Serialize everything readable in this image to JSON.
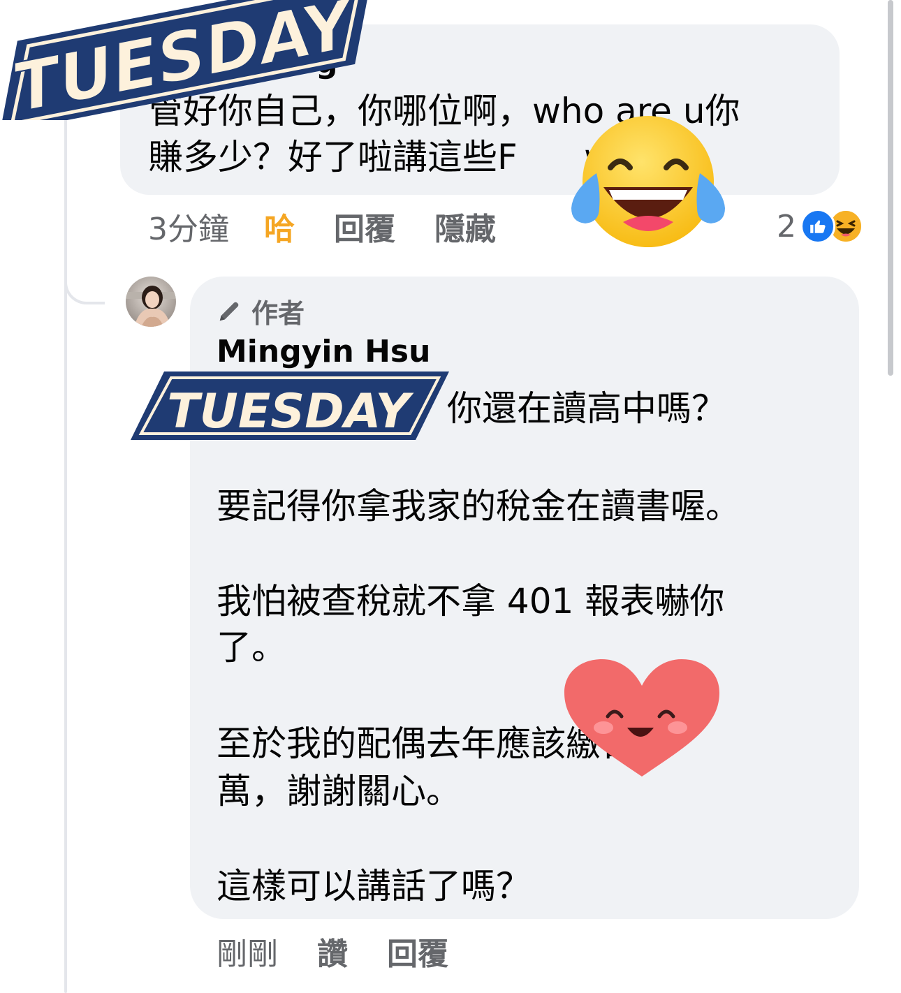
{
  "comment": {
    "author_partial": "g",
    "text": "管好你自己，你哪位啊，who are u你\n賺多少？好了啦講這些F      words",
    "time": "3分鐘",
    "reaction_label": "哈",
    "reply_label": "回覆",
    "hide_label": "隱藏",
    "reaction_count": "2"
  },
  "reply": {
    "badge": "作者",
    "author": "Mingyin Hsu",
    "lines": [
      "你還在讀高中嗎？",
      "要記得你拿我家的稅金在讀書喔。",
      "我怕被查稅就不拿 401 報表嚇你",
      "了。",
      "至於我的配偶去年應該繳百多",
      "萬，謝謝關心。",
      "這樣可以講話了嗎？"
    ],
    "time": "剛剛",
    "like_label": "讚",
    "reply_label": "回覆"
  },
  "watermark": {
    "text": "TUESDAY"
  },
  "colors": {
    "bubble": "#f0f2f5",
    "secondary_text": "#65676b",
    "haha_active": "#f5a623",
    "like_blue": "#1877f2",
    "badge_navy": "#1f3b73",
    "badge_cream": "#fdf1dc"
  },
  "icons": {
    "author_badge": "pencil-icon",
    "reaction_like": "thumbs-up-icon",
    "reaction_haha": "laughing-emoji-icon",
    "overlay_1": "tears-of-joy-emoji-icon",
    "overlay_2": "smiling-heart-icon"
  }
}
